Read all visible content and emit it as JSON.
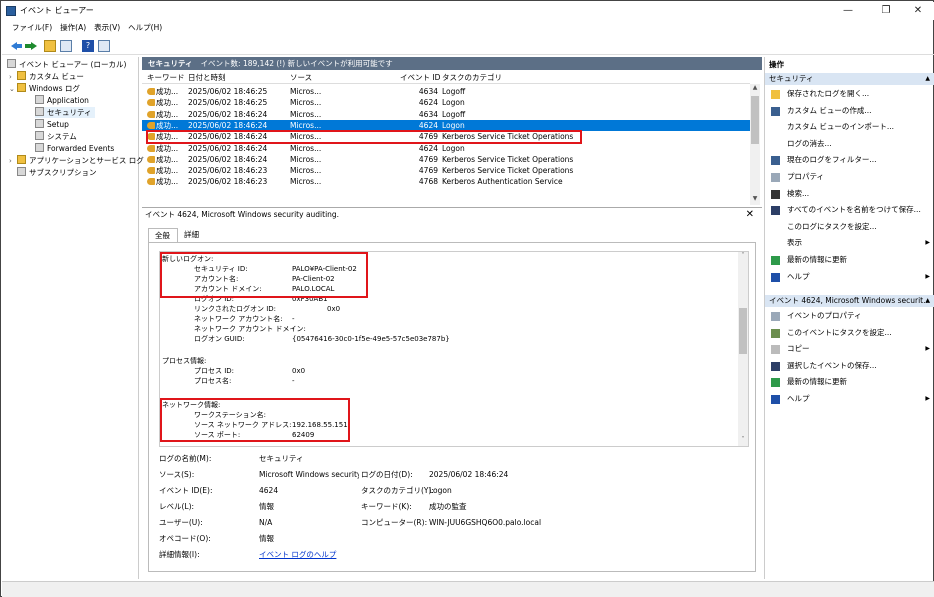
{
  "window": {
    "title": "イベント ビューアー",
    "minimize": "—",
    "maximize": "❐",
    "close": "✕"
  },
  "menu": [
    "ファイル(F)",
    "操作(A)",
    "表示(V)",
    "ヘルプ(H)"
  ],
  "tree": {
    "root": "イベント ビューアー (ローカル)",
    "custom_views": "カスタム ビュー",
    "windows_logs": "Windows ログ",
    "application": "Application",
    "security": "セキュリティ",
    "setup": "Setup",
    "system": "システム",
    "forwarded": "Forwarded Events",
    "app_services": "アプリケーションとサービス ログ",
    "subscriptions": "サブスクリプション"
  },
  "header": {
    "log_name": "セキュリティ",
    "summary": "イベント数: 189,142 (!) 新しいイベントが利用可能です"
  },
  "columns": {
    "keyword": "キーワード",
    "datetime": "日付と時刻",
    "source": "ソース",
    "event_id": "イベント ID",
    "task": "タスクのカテゴリ"
  },
  "events": [
    {
      "kw": "成功...",
      "dt": "2025/06/02 18:46:25",
      "src": "Micros...",
      "id": "4634",
      "task": "Logoff"
    },
    {
      "kw": "成功...",
      "dt": "2025/06/02 18:46:25",
      "src": "Micros...",
      "id": "4624",
      "task": "Logon"
    },
    {
      "kw": "成功...",
      "dt": "2025/06/02 18:46:24",
      "src": "Micros...",
      "id": "4634",
      "task": "Logoff"
    },
    {
      "kw": "成功...",
      "dt": "2025/06/02 18:46:24",
      "src": "Micros...",
      "id": "4624",
      "task": "Logon"
    },
    {
      "kw": "成功...",
      "dt": "2025/06/02 18:46:24",
      "src": "Micros...",
      "id": "4769",
      "task": "Kerberos Service Ticket Operations"
    },
    {
      "kw": "成功...",
      "dt": "2025/06/02 18:46:24",
      "src": "Micros...",
      "id": "4624",
      "task": "Logon"
    },
    {
      "kw": "成功...",
      "dt": "2025/06/02 18:46:24",
      "src": "Micros...",
      "id": "4769",
      "task": "Kerberos Service Ticket Operations"
    },
    {
      "kw": "成功...",
      "dt": "2025/06/02 18:46:23",
      "src": "Micros...",
      "id": "4769",
      "task": "Kerberos Service Ticket Operations"
    },
    {
      "kw": "成功...",
      "dt": "2025/06/02 18:46:23",
      "src": "Micros...",
      "id": "4768",
      "task": "Kerberos Authentication Service"
    }
  ],
  "selected_event_index": 3,
  "detail": {
    "title": "イベント 4624, Microsoft Windows security auditing.",
    "close": "✕",
    "tab_general": "全般",
    "tab_details": "詳細",
    "message": {
      "new_logon": "新しいログオン:",
      "security_id_label": "セキュリティ ID:",
      "security_id": "PALO¥PA-Client-02",
      "account_name_label": "アカウント名:",
      "account_name": "PA-Client-02",
      "account_domain_label": "アカウント ドメイン:",
      "account_domain": "PALO.LOCAL",
      "logon_id_label": "ログオン ID:",
      "logon_id": "0xF30AB1",
      "linked_logon_label": "リンクされたログオン ID:",
      "linked_logon": "0x0",
      "net_account_name_label": "ネットワーク アカウント名:",
      "net_account_name": "-",
      "net_account_domain_label": "ネットワーク アカウント ドメイン:",
      "net_account_domain": "-",
      "logon_guid_label": "ログオン GUID:",
      "logon_guid": "{05476416-30c0-1f5e-49e5-57c5e03e787b}",
      "process_info": "プロセス情報:",
      "process_id_label": "プロセス ID:",
      "process_id": "0x0",
      "process_name_label": "プロセス名:",
      "process_name": "-",
      "network_info": "ネットワーク情報:",
      "workstation_label": "ワークステーション名:",
      "workstation": "-",
      "source_addr_label": "ソース ネットワーク アドレス:",
      "source_addr": "192.168.55.151",
      "source_port_label": "ソース ポート:",
      "source_port": "62409"
    },
    "props": {
      "log_name_label": "ログの名前(M):",
      "log_name": "セキュリティ",
      "source_label": "ソース(S):",
      "source": "Microsoft Windows security auc",
      "logged_label": "ログの日付(D):",
      "logged": "2025/06/02 18:46:24",
      "event_id_label": "イベント ID(E):",
      "event_id": "4624",
      "task_label": "タスクのカテゴリ(Y):",
      "task": "Logon",
      "level_label": "レベル(L):",
      "level": "情報",
      "keywords_label": "キーワード(K):",
      "keywords": "成功の監査",
      "user_label": "ユーザー(U):",
      "user": "N/A",
      "computer_label": "コンピューター(R):",
      "computer": "WIN-JUU6GSHQ6O0.palo.local",
      "opcode_label": "オペコード(O):",
      "opcode": "情報",
      "more_info_label": "詳細情報(I):",
      "more_info": "イベント ログのヘルプ"
    }
  },
  "actions": {
    "header": "操作",
    "section1": "セキュリティ",
    "items1": [
      {
        "label": "保存されたログを開く...",
        "icon": "folder-open-icon"
      },
      {
        "label": "カスタム ビューの作成...",
        "icon": "filter-icon"
      },
      {
        "label": "カスタム ビューのインポート...",
        "icon": ""
      },
      {
        "label": "ログの消去...",
        "icon": ""
      },
      {
        "label": "現在のログをフィルター...",
        "icon": "filter-icon"
      },
      {
        "label": "プロパティ",
        "icon": "properties-icon"
      },
      {
        "label": "検索...",
        "icon": "binoculars-icon"
      },
      {
        "label": "すべてのイベントを名前をつけて保存...",
        "icon": "save-icon"
      },
      {
        "label": "このログにタスクを設定...",
        "icon": ""
      },
      {
        "label": "表示",
        "icon": "",
        "submenu": true
      },
      {
        "label": "最新の情報に更新",
        "icon": "refresh-icon"
      },
      {
        "label": "ヘルプ",
        "icon": "help-icon",
        "submenu": true
      }
    ],
    "section2": "イベント 4624, Microsoft Windows securit...",
    "items2": [
      {
        "label": "イベントのプロパティ",
        "icon": "properties-icon"
      },
      {
        "label": "このイベントにタスクを設定...",
        "icon": "task-icon"
      },
      {
        "label": "コピー",
        "icon": "copy-icon",
        "submenu": true
      },
      {
        "label": "選択したイベントの保存...",
        "icon": "save-icon"
      },
      {
        "label": "最新の情報に更新",
        "icon": "refresh-icon"
      },
      {
        "label": "ヘルプ",
        "icon": "help-icon",
        "submenu": true
      }
    ]
  },
  "colors": {
    "selection": "#0078d7",
    "header_bar": "#5c6f86",
    "highlight_box": "#e0151a",
    "action_section": "#d9e5f3"
  }
}
